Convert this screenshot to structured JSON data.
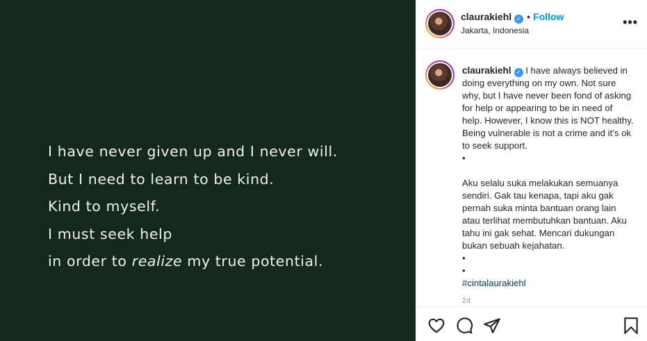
{
  "post": {
    "quote_lines": [
      "I have never given up and I never will.",
      "But I need to learn to be kind.",
      "Kind to myself.",
      "I must seek help"
    ],
    "quote_last_prefix": "in order to ",
    "quote_last_italic": "realize",
    "quote_last_suffix": " my true potential.",
    "background_color": "#15281f"
  },
  "header": {
    "username": "claurakiehl",
    "verified_icon": "verified-badge-icon",
    "separator": "•",
    "follow_label": "Follow",
    "location": "Jakarta, Indonesia",
    "more_icon": "more-options-icon"
  },
  "caption": {
    "username": "claurakiehl",
    "text_en": "I have always believed in doing everything on my own. Not sure why, but I have never been fond of asking for help or appearing to be in need of help. However, I know this is NOT healthy. Being vulnerable is not a crime and it’s ok to seek support.",
    "bullet1": "•",
    "text_id": "Aku selalu suka melakukan semuanya sendiri. Gak tau kenapa, tapi aku gak pernah suka minta bantuan orang lain atau terlihat membutuhkan bantuan. Aku tahu ini gak sehat. Mencari dukungan bukan sebuah kejahatan.",
    "bullet2": "•",
    "bullet3": "•",
    "hashtag": "#cintalaurakiehl",
    "time_ago": "2d"
  },
  "actions": {
    "icons": [
      "heart-icon",
      "comment-icon",
      "share-icon",
      "bookmark-icon"
    ]
  },
  "colors": {
    "follow": "#0095f6",
    "hashtag": "#00376b",
    "verified": "#3897f0"
  }
}
